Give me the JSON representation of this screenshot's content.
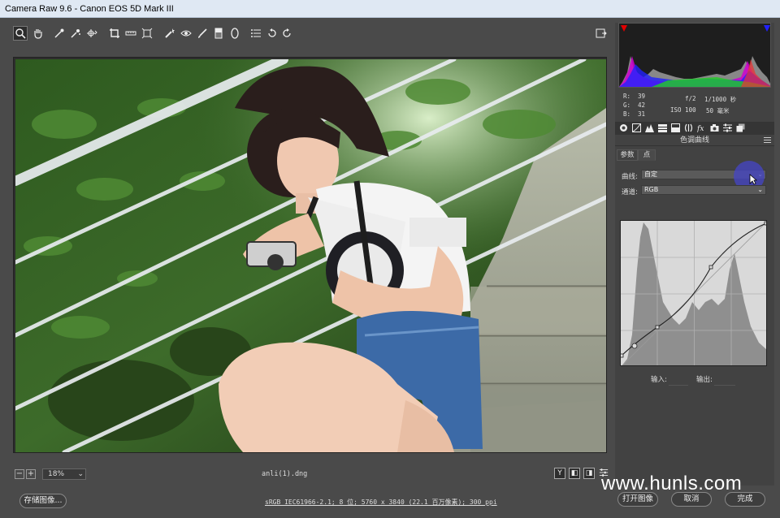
{
  "window": {
    "title": "Camera Raw 9.6 -  Canon EOS 5D Mark III"
  },
  "toolbar": {
    "tools": [
      {
        "icon": "zoom-icon",
        "active": true
      },
      {
        "icon": "hand-icon"
      },
      {
        "icon": "white-balance-icon"
      },
      {
        "icon": "color-sampler-icon"
      },
      {
        "icon": "target-adjustment-icon"
      },
      {
        "icon": "crop-icon"
      },
      {
        "icon": "straighten-icon"
      },
      {
        "icon": "transform-icon"
      },
      {
        "icon": "spot-removal-icon"
      },
      {
        "icon": "red-eye-icon"
      },
      {
        "icon": "adjustment-brush-icon"
      },
      {
        "icon": "graduated-filter-icon"
      },
      {
        "icon": "radial-filter-icon"
      },
      {
        "icon": "preferences-icon"
      },
      {
        "icon": "rotate-left-icon"
      },
      {
        "icon": "rotate-right-icon"
      }
    ]
  },
  "status": {
    "zoom_value": "18%",
    "zoom_out_label": "−",
    "zoom_in_label": "+",
    "filename": "anli(1).dng",
    "view_y_label": "Y",
    "view_label_1": "◧",
    "view_label_2": "◨"
  },
  "histogram": {
    "r_label": "R:",
    "r_value": "39",
    "g_label": "G:",
    "g_value": "42",
    "b_label": "B:",
    "b_value": "31",
    "aperture": "f/2",
    "shutter": "1/1000 秒",
    "iso": "ISO 100",
    "focal": "50 毫米"
  },
  "panel": {
    "title": "色调曲线",
    "subtab_parametric": "参数",
    "subtab_point": "点",
    "curve_label": "曲线:",
    "curve_value": "自定",
    "channel_label": "通道:",
    "channel_value": "RGB",
    "input_label": "输入:",
    "output_label": "输出:"
  },
  "bottom": {
    "save_label": "存储图像...",
    "workflow": "sRGB IEC61966-2.1; 8 位; 5760 x 3840 (22.1 百万像素); 300 ppi",
    "open_label": "打开图像",
    "cancel_label": "取消",
    "done_label": "完成"
  },
  "watermark": "www.hunls.com",
  "colors": {
    "app_bg": "#4a4a4a",
    "accent_blue": "#3b3bd0",
    "histogram_magenta": "#e000e0"
  }
}
